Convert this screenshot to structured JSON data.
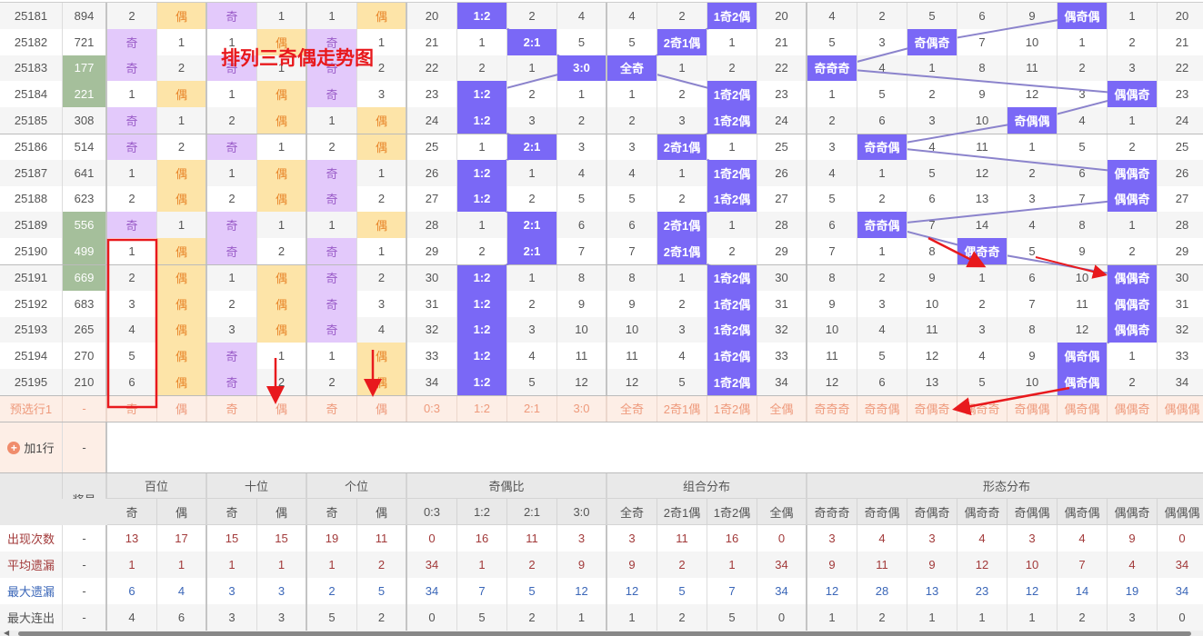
{
  "title": "排列三奇偶走势图",
  "rows": [
    {
      "issue": "25181",
      "number": "894",
      "hot": false,
      "cells": [
        "2",
        "偶",
        "奇",
        "1",
        "1",
        "偶",
        "20",
        "1:2",
        "2",
        "4",
        "4",
        "2",
        "1奇2偶",
        "20",
        "4",
        "2",
        "5",
        "6",
        "9",
        "偶奇偶",
        "1",
        "20"
      ]
    },
    {
      "issue": "25182",
      "number": "721",
      "hot": false,
      "cells": [
        "奇",
        "1",
        "1",
        "偶",
        "奇",
        "1",
        "21",
        "1",
        "2:1",
        "5",
        "5",
        "2奇1偶",
        "1",
        "21",
        "5",
        "3",
        "奇偶奇",
        "7",
        "10",
        "1",
        "2",
        "21"
      ]
    },
    {
      "issue": "25183",
      "number": "177",
      "hot": true,
      "cells": [
        "奇",
        "2",
        "奇",
        "1",
        "奇",
        "2",
        "22",
        "2",
        "1",
        "3:0",
        "全奇",
        "1",
        "2",
        "22",
        "奇奇奇",
        "4",
        "1",
        "8",
        "11",
        "2",
        "3",
        "22"
      ]
    },
    {
      "issue": "25184",
      "number": "221",
      "hot": true,
      "cells": [
        "1",
        "偶",
        "1",
        "偶",
        "奇",
        "3",
        "23",
        "1:2",
        "2",
        "1",
        "1",
        "2",
        "1奇2偶",
        "23",
        "1",
        "5",
        "2",
        "9",
        "12",
        "3",
        "偶偶奇",
        "23"
      ]
    },
    {
      "issue": "25185",
      "number": "308",
      "hot": false,
      "cells": [
        "奇",
        "1",
        "2",
        "偶",
        "1",
        "偶",
        "24",
        "1:2",
        "3",
        "2",
        "2",
        "3",
        "1奇2偶",
        "24",
        "2",
        "6",
        "3",
        "10",
        "奇偶偶",
        "4",
        "1",
        "24"
      ]
    },
    {
      "issue": "25186",
      "number": "514",
      "hot": false,
      "cells": [
        "奇",
        "2",
        "奇",
        "1",
        "2",
        "偶",
        "25",
        "1",
        "2:1",
        "3",
        "3",
        "2奇1偶",
        "1",
        "25",
        "3",
        "奇奇偶",
        "4",
        "11",
        "1",
        "5",
        "2",
        "25"
      ]
    },
    {
      "issue": "25187",
      "number": "641",
      "hot": false,
      "cells": [
        "1",
        "偶",
        "1",
        "偶",
        "奇",
        "1",
        "26",
        "1:2",
        "1",
        "4",
        "4",
        "1",
        "1奇2偶",
        "26",
        "4",
        "1",
        "5",
        "12",
        "2",
        "6",
        "偶偶奇",
        "26"
      ]
    },
    {
      "issue": "25188",
      "number": "623",
      "hot": false,
      "cells": [
        "2",
        "偶",
        "2",
        "偶",
        "奇",
        "2",
        "27",
        "1:2",
        "2",
        "5",
        "5",
        "2",
        "1奇2偶",
        "27",
        "5",
        "2",
        "6",
        "13",
        "3",
        "7",
        "偶偶奇",
        "27"
      ]
    },
    {
      "issue": "25189",
      "number": "556",
      "hot": true,
      "cells": [
        "奇",
        "1",
        "奇",
        "1",
        "1",
        "偶",
        "28",
        "1",
        "2:1",
        "6",
        "6",
        "2奇1偶",
        "1",
        "28",
        "6",
        "奇奇偶",
        "7",
        "14",
        "4",
        "8",
        "1",
        "28"
      ]
    },
    {
      "issue": "25190",
      "number": "499",
      "hot": true,
      "cells": [
        "1",
        "偶",
        "奇",
        "2",
        "奇",
        "1",
        "29",
        "2",
        "2:1",
        "7",
        "7",
        "2奇1偶",
        "2",
        "29",
        "7",
        "1",
        "8",
        "偶奇奇",
        "5",
        "9",
        "2",
        "29"
      ]
    },
    {
      "issue": "25191",
      "number": "669",
      "hot": true,
      "cells": [
        "2",
        "偶",
        "1",
        "偶",
        "奇",
        "2",
        "30",
        "1:2",
        "1",
        "8",
        "8",
        "1",
        "1奇2偶",
        "30",
        "8",
        "2",
        "9",
        "1",
        "6",
        "10",
        "偶偶奇",
        "30"
      ]
    },
    {
      "issue": "25192",
      "number": "683",
      "hot": false,
      "cells": [
        "3",
        "偶",
        "2",
        "偶",
        "奇",
        "3",
        "31",
        "1:2",
        "2",
        "9",
        "9",
        "2",
        "1奇2偶",
        "31",
        "9",
        "3",
        "10",
        "2",
        "7",
        "11",
        "偶偶奇",
        "31"
      ]
    },
    {
      "issue": "25193",
      "number": "265",
      "hot": false,
      "cells": [
        "4",
        "偶",
        "3",
        "偶",
        "奇",
        "4",
        "32",
        "1:2",
        "3",
        "10",
        "10",
        "3",
        "1奇2偶",
        "32",
        "10",
        "4",
        "11",
        "3",
        "8",
        "12",
        "偶偶奇",
        "32"
      ]
    },
    {
      "issue": "25194",
      "number": "270",
      "hot": false,
      "cells": [
        "5",
        "偶",
        "奇",
        "1",
        "1",
        "偶",
        "33",
        "1:2",
        "4",
        "11",
        "11",
        "4",
        "1奇2偶",
        "33",
        "11",
        "5",
        "12",
        "4",
        "9",
        "偶奇偶",
        "1",
        "33"
      ]
    },
    {
      "issue": "25195",
      "number": "210",
      "hot": false,
      "cells": [
        "6",
        "偶",
        "奇",
        "2",
        "2",
        "偶",
        "34",
        "1:2",
        "5",
        "12",
        "12",
        "5",
        "1奇2偶",
        "34",
        "12",
        "6",
        "13",
        "5",
        "10",
        "偶奇偶",
        "2",
        "34"
      ]
    }
  ],
  "preselect": {
    "label": "预选行1",
    "number": "-",
    "cells": [
      "奇",
      "偶",
      "奇",
      "偶",
      "奇",
      "偶",
      "0:3",
      "1:2",
      "2:1",
      "3:0",
      "全奇",
      "2奇1偶",
      "1奇2偶",
      "全偶",
      "奇奇奇",
      "奇奇偶",
      "奇偶奇",
      "偶奇奇",
      "奇偶偶",
      "偶奇偶",
      "偶偶奇",
      "偶偶偶"
    ]
  },
  "add_row": {
    "label": "加1行",
    "plus": "+",
    "number": "-"
  },
  "header": {
    "corner": "-",
    "number": "奖号",
    "groups": [
      {
        "label": "百位",
        "span": 2
      },
      {
        "label": "十位",
        "span": 2
      },
      {
        "label": "个位",
        "span": 2
      },
      {
        "label": "奇偶比",
        "span": 4
      },
      {
        "label": "组合分布",
        "span": 4
      },
      {
        "label": "形态分布",
        "span": 8
      }
    ],
    "sub": [
      "奇",
      "偶",
      "奇",
      "偶",
      "奇",
      "偶",
      "0:3",
      "1:2",
      "2:1",
      "3:0",
      "全奇",
      "2奇1偶",
      "1奇2偶",
      "全偶",
      "奇奇奇",
      "奇奇偶",
      "奇偶奇",
      "偶奇奇",
      "奇偶偶",
      "偶奇偶",
      "偶偶奇",
      "偶偶偶"
    ]
  },
  "stats": [
    {
      "label": "出现次数",
      "style": "red",
      "number": "-",
      "values": [
        "13",
        "17",
        "15",
        "15",
        "19",
        "11",
        "0",
        "16",
        "11",
        "3",
        "3",
        "11",
        "16",
        "0",
        "3",
        "4",
        "3",
        "4",
        "3",
        "4",
        "9",
        "0"
      ]
    },
    {
      "label": "平均遗漏",
      "style": "red",
      "number": "-",
      "values": [
        "1",
        "1",
        "1",
        "1",
        "1",
        "2",
        "34",
        "1",
        "2",
        "9",
        "9",
        "2",
        "1",
        "34",
        "9",
        "11",
        "9",
        "12",
        "10",
        "7",
        "4",
        "34"
      ]
    },
    {
      "label": "最大遗漏",
      "style": "blue",
      "number": "-",
      "values": [
        "6",
        "4",
        "3",
        "3",
        "2",
        "5",
        "34",
        "7",
        "5",
        "12",
        "12",
        "5",
        "7",
        "34",
        "12",
        "28",
        "13",
        "23",
        "12",
        "14",
        "19",
        "34"
      ]
    },
    {
      "label": "最大连出",
      "style": "gray",
      "number": "-",
      "values": [
        "4",
        "6",
        "3",
        "3",
        "5",
        "2",
        "0",
        "5",
        "2",
        "1",
        "1",
        "2",
        "5",
        "0",
        "1",
        "2",
        "1",
        "1",
        "1",
        "2",
        "3",
        "0"
      ]
    }
  ],
  "colors": {
    "hit": "#7a68f6",
    "odd": "#e3c9fb",
    "even": "#fde4a8",
    "hot_number": "#a5bf9b",
    "trend_line": "#8b83cc",
    "annotation": "#e8191d"
  }
}
